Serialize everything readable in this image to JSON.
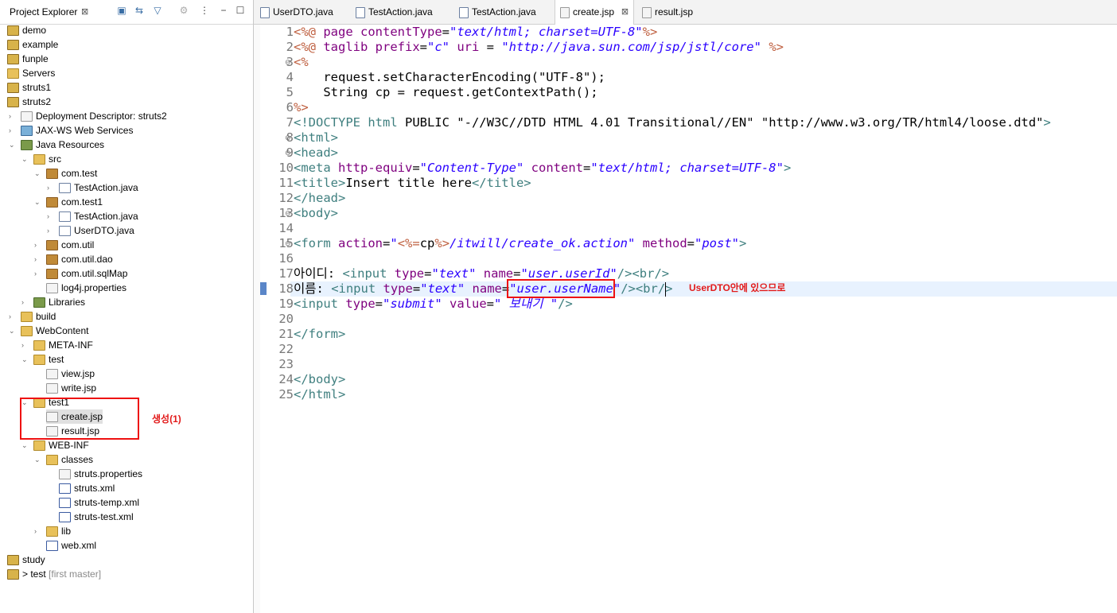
{
  "left": {
    "title": "Project Explorer",
    "tree": [
      {
        "label": "demo",
        "icon": "project-icon",
        "twisty": "›"
      },
      {
        "label": "example",
        "icon": "project-icon",
        "twisty": "›"
      },
      {
        "label": "funple",
        "icon": "project-icon",
        "twisty": "›"
      },
      {
        "label": "Servers",
        "icon": "folder-icon",
        "twisty": "›"
      },
      {
        "label": "struts1",
        "icon": "project-icon",
        "twisty": "›"
      },
      {
        "label": "struts2",
        "icon": "project-icon",
        "twisty": "⌄"
      },
      {
        "label": "Deployment Descriptor: struts2",
        "icon": "descriptor-icon",
        "twisty": "›"
      },
      {
        "label": "JAX-WS Web Services",
        "icon": "webservices-icon",
        "twisty": "›"
      },
      {
        "label": "Java Resources",
        "icon": "java-resources-icon",
        "twisty": "⌄"
      },
      {
        "label": "src",
        "icon": "source-folder-icon",
        "twisty": "⌄"
      },
      {
        "label": "com.test",
        "icon": "package-icon",
        "twisty": "⌄"
      },
      {
        "label": "TestAction.java",
        "icon": "java-file-icon",
        "twisty": "›"
      },
      {
        "label": "com.test1",
        "icon": "package-icon",
        "twisty": "⌄"
      },
      {
        "label": "TestAction.java",
        "icon": "java-file-icon",
        "twisty": "›"
      },
      {
        "label": "UserDTO.java",
        "icon": "java-file-icon",
        "twisty": "›"
      },
      {
        "label": "com.util",
        "icon": "package-icon",
        "twisty": "›"
      },
      {
        "label": "com.util.dao",
        "icon": "package-icon",
        "twisty": "›"
      },
      {
        "label": "com.util.sqlMap",
        "icon": "package-icon",
        "twisty": "›"
      },
      {
        "label": "log4j.properties",
        "icon": "file-icon",
        "twisty": ""
      },
      {
        "label": "Libraries",
        "icon": "library-icon",
        "twisty": "›"
      },
      {
        "label": "build",
        "icon": "folder-icon",
        "twisty": "›"
      },
      {
        "label": "WebContent",
        "icon": "folder-icon",
        "twisty": "⌄"
      },
      {
        "label": "META-INF",
        "icon": "folder-icon",
        "twisty": "›"
      },
      {
        "label": "test",
        "icon": "folder-icon",
        "twisty": "⌄"
      },
      {
        "label": "view.jsp",
        "icon": "jsp-file-icon",
        "twisty": ""
      },
      {
        "label": "write.jsp",
        "icon": "jsp-file-icon",
        "twisty": ""
      },
      {
        "label": "test1",
        "icon": "folder-icon",
        "twisty": "⌄"
      },
      {
        "label": "create.jsp",
        "icon": "jsp-file-icon",
        "twisty": ""
      },
      {
        "label": "result.jsp",
        "icon": "jsp-file-icon",
        "twisty": ""
      },
      {
        "label": "WEB-INF",
        "icon": "folder-icon",
        "twisty": "⌄"
      },
      {
        "label": "classes",
        "icon": "folder-icon",
        "twisty": "⌄"
      },
      {
        "label": "struts.properties",
        "icon": "file-icon",
        "twisty": ""
      },
      {
        "label": "struts.xml",
        "icon": "xml-file-icon",
        "twisty": ""
      },
      {
        "label": "struts-temp.xml",
        "icon": "xml-file-icon",
        "twisty": ""
      },
      {
        "label": "struts-test.xml",
        "icon": "xml-file-icon",
        "twisty": ""
      },
      {
        "label": "lib",
        "icon": "folder-icon",
        "twisty": "›"
      },
      {
        "label": "web.xml",
        "icon": "xml-file-icon",
        "twisty": ""
      },
      {
        "label": "study",
        "icon": "project-icon",
        "twisty": "›"
      },
      {
        "label": "> test",
        "icon": "project-icon",
        "twisty": "›",
        "suffix": "[first master]"
      }
    ],
    "annotation": "생성(1)"
  },
  "editor": {
    "tabs": [
      {
        "label": "UserDTO.java",
        "icon": "java-file-icon"
      },
      {
        "label": "TestAction.java",
        "icon": "java-file-icon"
      },
      {
        "label": "TestAction.java",
        "icon": "java-file-icon"
      },
      {
        "label": "create.jsp",
        "icon": "jsp-file-icon",
        "active": true
      },
      {
        "label": "result.jsp",
        "icon": "jsp-file-icon"
      }
    ],
    "lines": [
      {
        "n": "1",
        "fold": "",
        "segs": [
          [
            "dl",
            "<%@ "
          ],
          [
            "at",
            "page "
          ],
          [
            "at",
            "contentType"
          ],
          [
            "",
            "="
          ],
          [
            "av",
            "\"text/html; charset=UTF-8\""
          ],
          [
            "dl",
            "%>"
          ]
        ]
      },
      {
        "n": "2",
        "fold": "",
        "segs": [
          [
            "dl",
            "<%@ "
          ],
          [
            "at",
            "taglib "
          ],
          [
            "at",
            "prefix"
          ],
          [
            "",
            "="
          ],
          [
            "av",
            "\"c\""
          ],
          [
            "",
            " "
          ],
          [
            "at",
            "uri"
          ],
          [
            "",
            " = "
          ],
          [
            "av",
            "\"http://java.sun.com/jsp/jstl/core\""
          ],
          [
            "",
            " "
          ],
          [
            "dl",
            "%>"
          ]
        ]
      },
      {
        "n": "3",
        "fold": "⊖",
        "segs": [
          [
            "dl",
            "<%"
          ]
        ]
      },
      {
        "n": "4",
        "fold": "",
        "segs": [
          [
            "",
            "    request.setCharacterEncoding(\"UTF-8\");"
          ]
        ]
      },
      {
        "n": "5",
        "fold": "",
        "segs": [
          [
            "",
            "    String cp = request.getContextPath();"
          ]
        ]
      },
      {
        "n": "6",
        "fold": "",
        "segs": [
          [
            "dl",
            "%>"
          ]
        ]
      },
      {
        "n": "7",
        "fold": "",
        "segs": [
          [
            "tag",
            "<!DOCTYPE html "
          ],
          [
            "",
            "PUBLIC \"-//W3C//DTD HTML 4.01 Transitional//EN\" \"http://www.w3.org/TR/html4/loose.dtd\""
          ],
          [
            "tag",
            ">"
          ]
        ]
      },
      {
        "n": "8",
        "fold": "⊖",
        "segs": [
          [
            "tag",
            "<html>"
          ]
        ]
      },
      {
        "n": "9",
        "fold": "⊖",
        "segs": [
          [
            "tag",
            "<head>"
          ]
        ]
      },
      {
        "n": "10",
        "fold": "",
        "segs": [
          [
            "tag",
            "<meta "
          ],
          [
            "at",
            "http-equiv"
          ],
          [
            "",
            "="
          ],
          [
            "av",
            "\"Content-Type\""
          ],
          [
            "",
            " "
          ],
          [
            "at",
            "content"
          ],
          [
            "",
            "="
          ],
          [
            "av",
            "\"text/html; charset=UTF-8\""
          ],
          [
            "tag",
            ">"
          ]
        ]
      },
      {
        "n": "11",
        "fold": "",
        "segs": [
          [
            "tag",
            "<title>"
          ],
          [
            "",
            "Insert title here"
          ],
          [
            "tag",
            "</title>"
          ]
        ]
      },
      {
        "n": "12",
        "fold": "",
        "segs": [
          [
            "tag",
            "</head>"
          ]
        ]
      },
      {
        "n": "13",
        "fold": "⊖",
        "segs": [
          [
            "tag",
            "<body>"
          ]
        ]
      },
      {
        "n": "14",
        "fold": "",
        "segs": []
      },
      {
        "n": "15",
        "fold": "⊖",
        "segs": [
          [
            "tag",
            "<form "
          ],
          [
            "at",
            "action"
          ],
          [
            "",
            "="
          ],
          [
            "av",
            "\""
          ],
          [
            "dl",
            "<%="
          ],
          [
            "",
            "cp"
          ],
          [
            "dl",
            "%>"
          ],
          [
            "av",
            "/itwill/create_ok.action\""
          ],
          [
            "",
            " "
          ],
          [
            "at",
            "method"
          ],
          [
            "",
            "="
          ],
          [
            "av",
            "\"post\""
          ],
          [
            "tag",
            ">"
          ]
        ]
      },
      {
        "n": "16",
        "fold": "",
        "segs": []
      },
      {
        "n": "17",
        "fold": "",
        "segs": [
          [
            "",
            "아이디: "
          ],
          [
            "tag",
            "<input "
          ],
          [
            "at",
            "type"
          ],
          [
            "",
            "="
          ],
          [
            "av",
            "\"text\""
          ],
          [
            "",
            " "
          ],
          [
            "at",
            "name"
          ],
          [
            "",
            "="
          ],
          [
            "av",
            "\"user.userId\""
          ],
          [
            "tag",
            "/><br/>"
          ]
        ]
      },
      {
        "n": "18",
        "fold": "",
        "segs": [
          [
            "",
            "이름: "
          ],
          [
            "tag",
            "<input "
          ],
          [
            "at",
            "type"
          ],
          [
            "",
            "="
          ],
          [
            "av",
            "\"text\""
          ],
          [
            "",
            " "
          ],
          [
            "at",
            "name"
          ],
          [
            "",
            "="
          ],
          [
            "av",
            "\"user.userName\""
          ],
          [
            "tag",
            "/><br/>"
          ]
        ]
      },
      {
        "n": "19",
        "fold": "",
        "segs": [
          [
            "tag",
            "<input "
          ],
          [
            "at",
            "type"
          ],
          [
            "",
            "="
          ],
          [
            "av",
            "\"submit\""
          ],
          [
            "",
            " "
          ],
          [
            "at",
            "value"
          ],
          [
            "",
            "="
          ],
          [
            "av",
            "\" 보내기 \""
          ],
          [
            "tag",
            "/>"
          ]
        ]
      },
      {
        "n": "20",
        "fold": "",
        "segs": []
      },
      {
        "n": "21",
        "fold": "",
        "segs": [
          [
            "tag",
            "</form>"
          ]
        ]
      },
      {
        "n": "22",
        "fold": "",
        "segs": []
      },
      {
        "n": "23",
        "fold": "",
        "segs": []
      },
      {
        "n": "24",
        "fold": "",
        "segs": [
          [
            "tag",
            "</body>"
          ]
        ]
      },
      {
        "n": "25",
        "fold": "",
        "segs": [
          [
            "tag",
            "</html>"
          ]
        ]
      }
    ],
    "annotation": "UserDTO안에 있으므로"
  }
}
